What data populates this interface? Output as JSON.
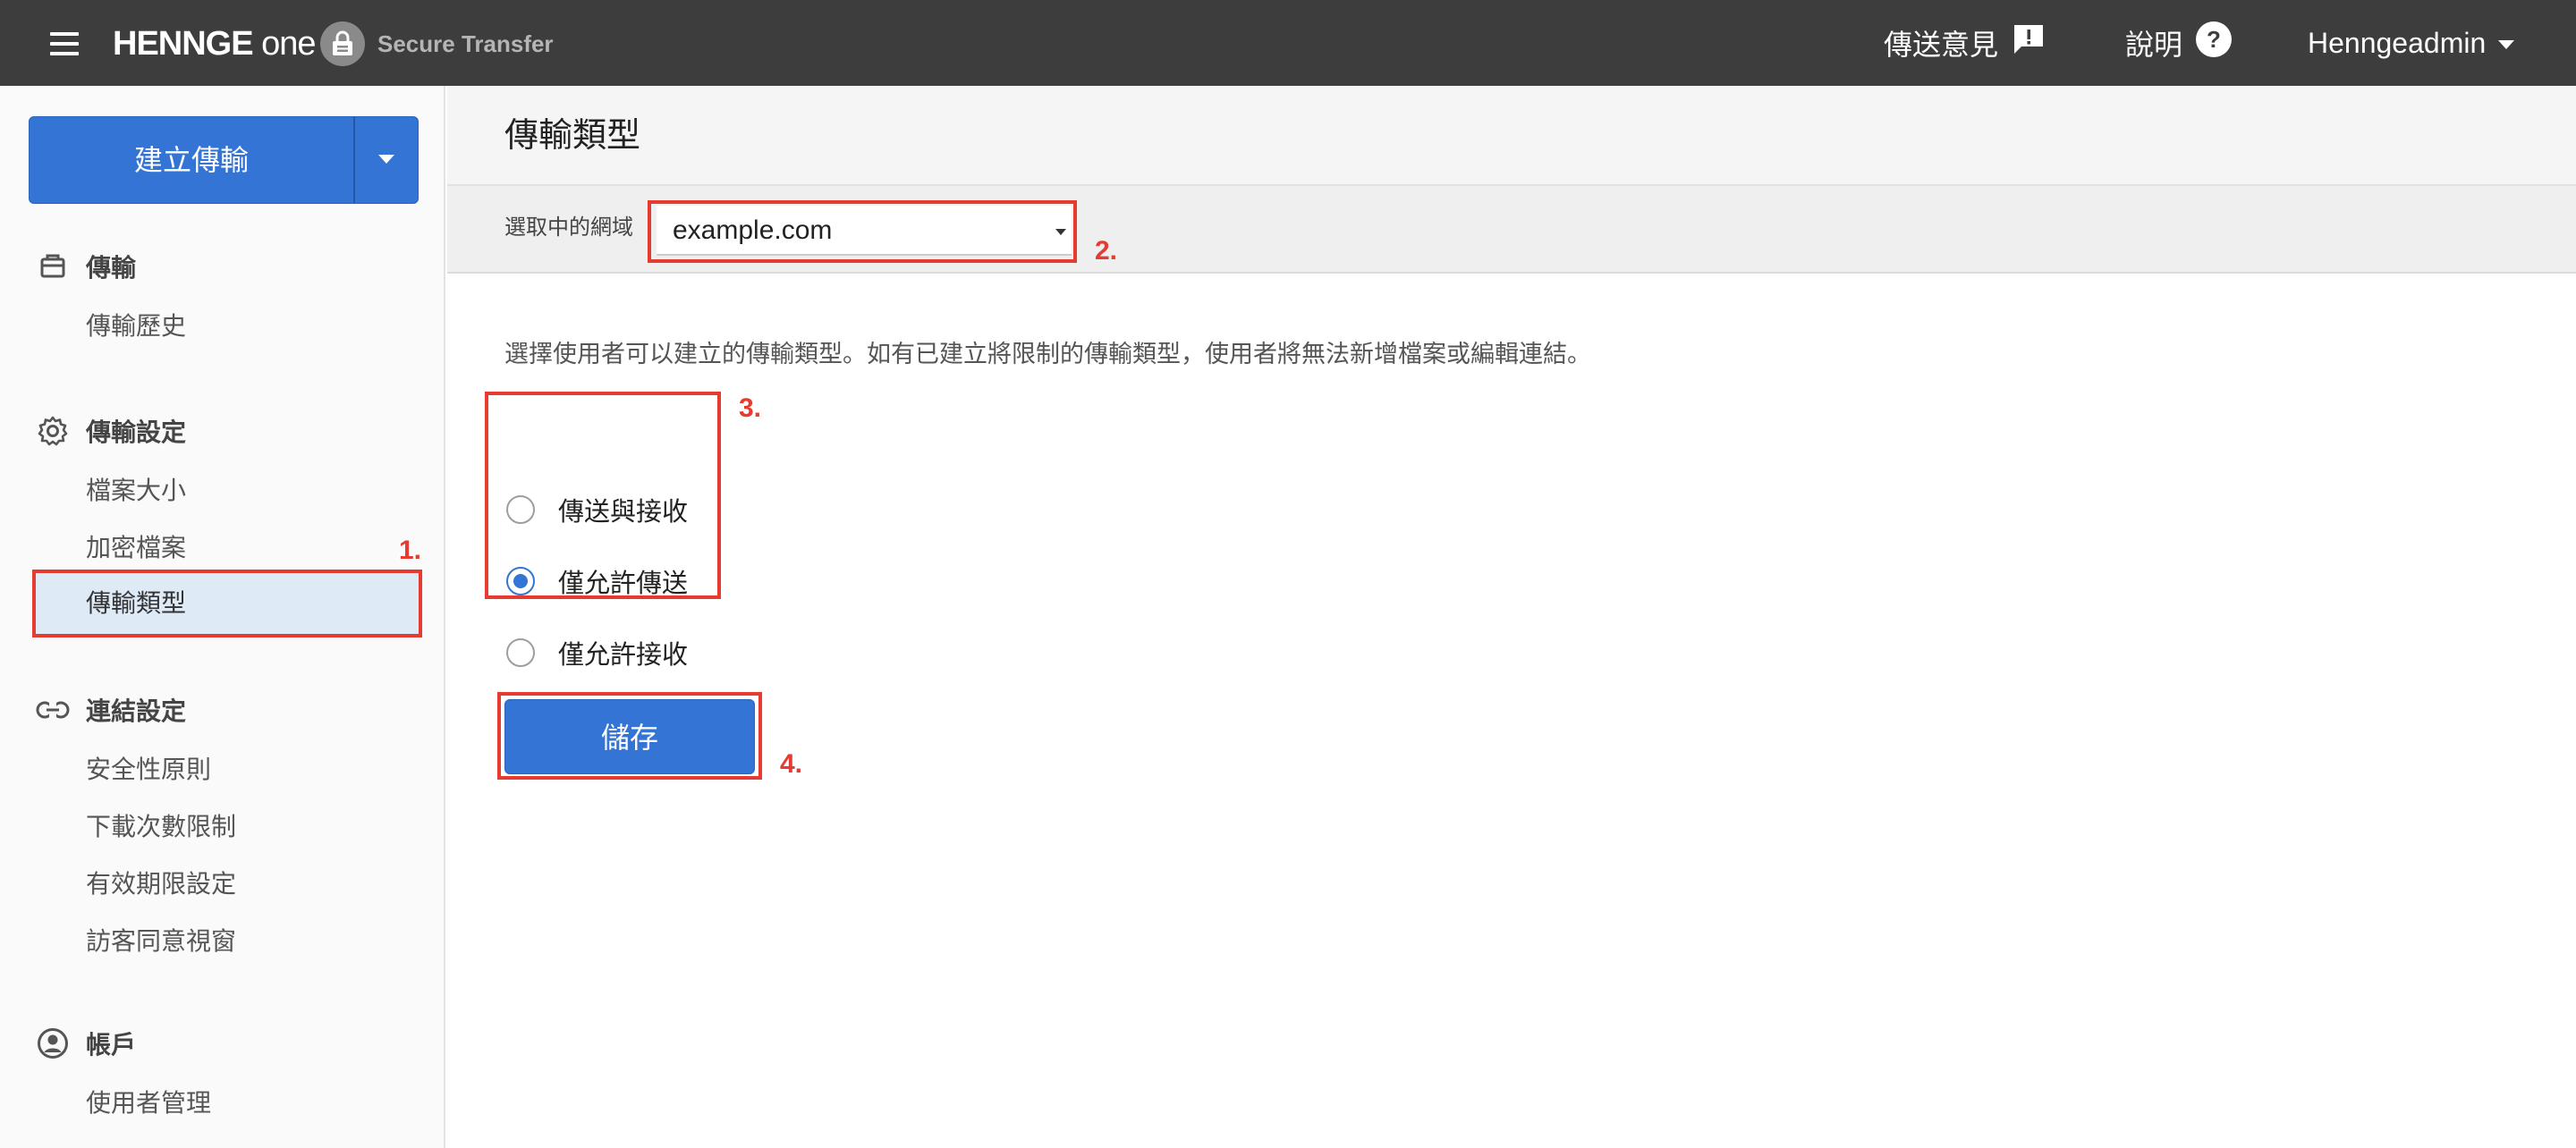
{
  "header": {
    "logo_main": "HENNGE",
    "logo_suffix": " one",
    "product": "Secure Transfer",
    "feedback_label": "傳送意見",
    "help_label": "說明",
    "user_label": "Henngeadmin"
  },
  "sidebar": {
    "create_button": "建立傳輸",
    "sections": [
      {
        "title": "傳輸",
        "icon": "package-icon",
        "items": [
          "傳輸歷史"
        ]
      },
      {
        "title": "傳輸設定",
        "icon": "gear-icon",
        "items": [
          "檔案大小",
          "加密檔案",
          "傳輸類型"
        ]
      },
      {
        "title": "連結設定",
        "icon": "link-icon",
        "items": [
          "安全性原則",
          "下載次數限制",
          "有效期限設定",
          "訪客同意視窗"
        ]
      },
      {
        "title": "帳戶",
        "icon": "account-icon",
        "items": [
          "使用者管理"
        ]
      }
    ],
    "active_item": "傳輸類型"
  },
  "main": {
    "page_title": "傳輸類型",
    "domain_label": "選取中的網域",
    "domain_value": "example.com",
    "description": "選擇使用者可以建立的傳輸類型。如有已建立將限制的傳輸類型，使用者將無法新增檔案或編輯連結。",
    "options": [
      "傳送與接收",
      "僅允許傳送",
      "僅允許接收"
    ],
    "selected_option": "僅允許傳送",
    "save_label": "儲存"
  },
  "annotations": [
    "1.",
    "2.",
    "3.",
    "4."
  ],
  "colors": {
    "topbar": "#3d3d3d",
    "accent": "#3374d5",
    "annotation_red": "#e53b30",
    "active_bg": "#dfeaf7"
  }
}
